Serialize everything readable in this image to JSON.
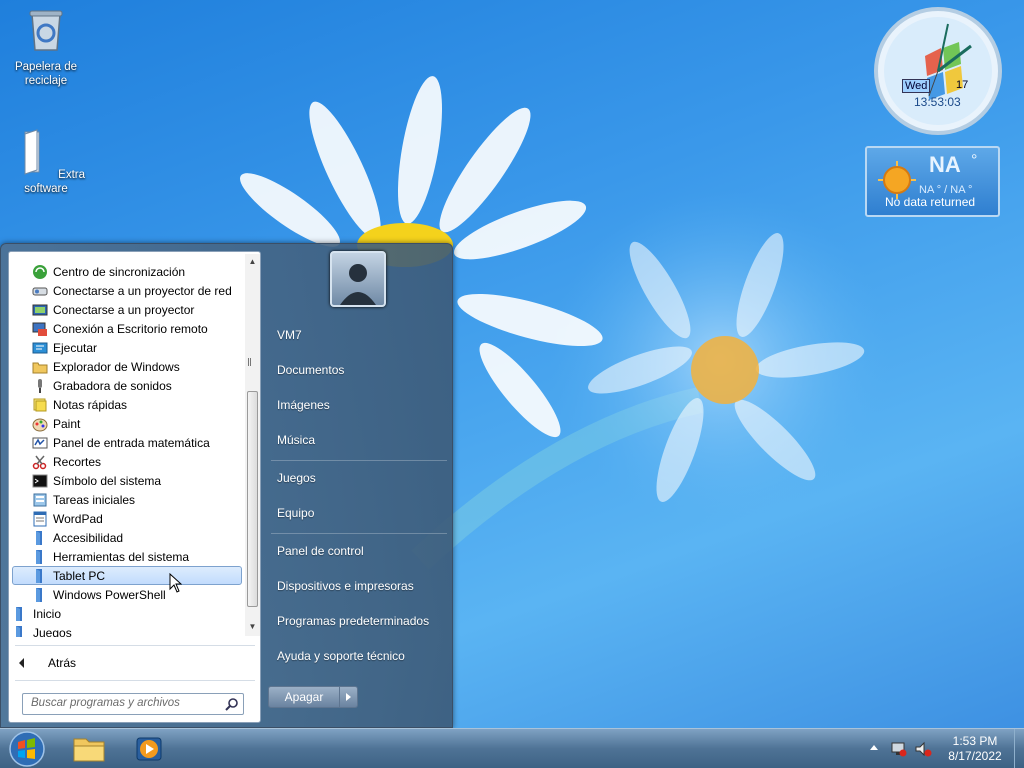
{
  "desktop": {
    "icons": [
      {
        "label": "Papelera de reciclaje"
      },
      {
        "label": "Extra software"
      }
    ]
  },
  "clock_gadget": {
    "day": "Wed",
    "date": "17",
    "time": "13:53:03"
  },
  "weather_gadget": {
    "temp": "NA",
    "degree": "°",
    "range": "NA ° / NA °",
    "status": "No data returned"
  },
  "start_menu": {
    "programs": [
      {
        "label": "Centro de sincronización",
        "icon": "sync-center-icon"
      },
      {
        "label": "Conectarse a un proyector de red",
        "icon": "network-projector-icon"
      },
      {
        "label": "Conectarse a un proyector",
        "icon": "projector-icon"
      },
      {
        "label": "Conexión a Escritorio remoto",
        "icon": "remote-desktop-icon"
      },
      {
        "label": "Ejecutar",
        "icon": "run-icon"
      },
      {
        "label": "Explorador de Windows",
        "icon": "explorer-folder-icon"
      },
      {
        "label": "Grabadora de sonidos",
        "icon": "microphone-icon"
      },
      {
        "label": "Notas rápidas",
        "icon": "sticky-notes-icon"
      },
      {
        "label": "Paint",
        "icon": "paint-palette-icon"
      },
      {
        "label": "Panel de entrada matemática",
        "icon": "math-input-icon"
      },
      {
        "label": "Recortes",
        "icon": "snipping-tool-icon"
      },
      {
        "label": "Símbolo del sistema",
        "icon": "command-prompt-icon"
      },
      {
        "label": "Tareas iniciales",
        "icon": "getting-started-icon"
      },
      {
        "label": "WordPad",
        "icon": "wordpad-icon"
      },
      {
        "label": "Accesibilidad",
        "icon": "folder-icon"
      },
      {
        "label": "Herramientas del sistema",
        "icon": "folder-icon"
      },
      {
        "label": "Tablet PC",
        "icon": "folder-icon",
        "selected": true
      },
      {
        "label": "Windows PowerShell",
        "icon": "folder-icon"
      },
      {
        "label": "Inicio",
        "icon": "folder-icon"
      },
      {
        "label": "Juegos",
        "icon": "folder-icon"
      }
    ],
    "back_label": "Atrás",
    "search_placeholder": "Buscar programas y archivos",
    "right_items": [
      "VM7",
      "Documentos",
      "Imágenes",
      "Música",
      "Juegos",
      "Equipo",
      "Panel de control",
      "Dispositivos e impresoras",
      "Programas predeterminados",
      "Ayuda y soporte técnico"
    ],
    "shutdown_label": "Apagar"
  },
  "taskbar": {
    "pinned": [
      "explorer-folder-icon",
      "media-player-icon"
    ],
    "tray_time": "1:53 PM",
    "tray_date": "8/17/2022"
  },
  "colors": {
    "desktop_blue": "#3a98ea",
    "selection": "#c2dcfd",
    "taskbar": "#4f7396"
  }
}
